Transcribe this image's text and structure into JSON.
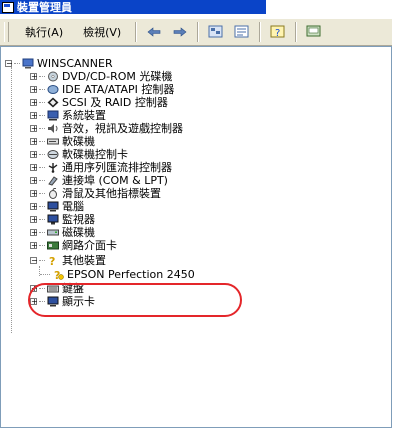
{
  "window": {
    "title": "裝置管理員"
  },
  "toolbar": {
    "action_menu": "執行(A)",
    "view_menu": "檢視(V)",
    "buttons": [
      "back-icon",
      "forward-icon",
      "device-view-icon",
      "properties-icon",
      "help-icon",
      "scan-hardware-icon"
    ]
  },
  "tree": {
    "root": "WINSCANNER",
    "items": [
      "DVD/CD-ROM 光碟機",
      "IDE ATA/ATAPI 控制器",
      "SCSI 及 RAID 控制器",
      "系統裝置",
      "音效，視訊及遊戲控制器",
      "軟碟機",
      "軟碟機控制卡",
      "通用序列匯流排控制器",
      "連接埠 (COM & LPT)",
      "滑鼠及其他指標裝置",
      "電腦",
      "監視器",
      "磁碟機",
      "網路介面卡",
      "其他裝置",
      "EPSON Perfection 2450",
      "鍵盤",
      "顯示卡"
    ]
  },
  "colors": {
    "titlebar": "#0a44c8",
    "highlight": "#e4262a"
  }
}
